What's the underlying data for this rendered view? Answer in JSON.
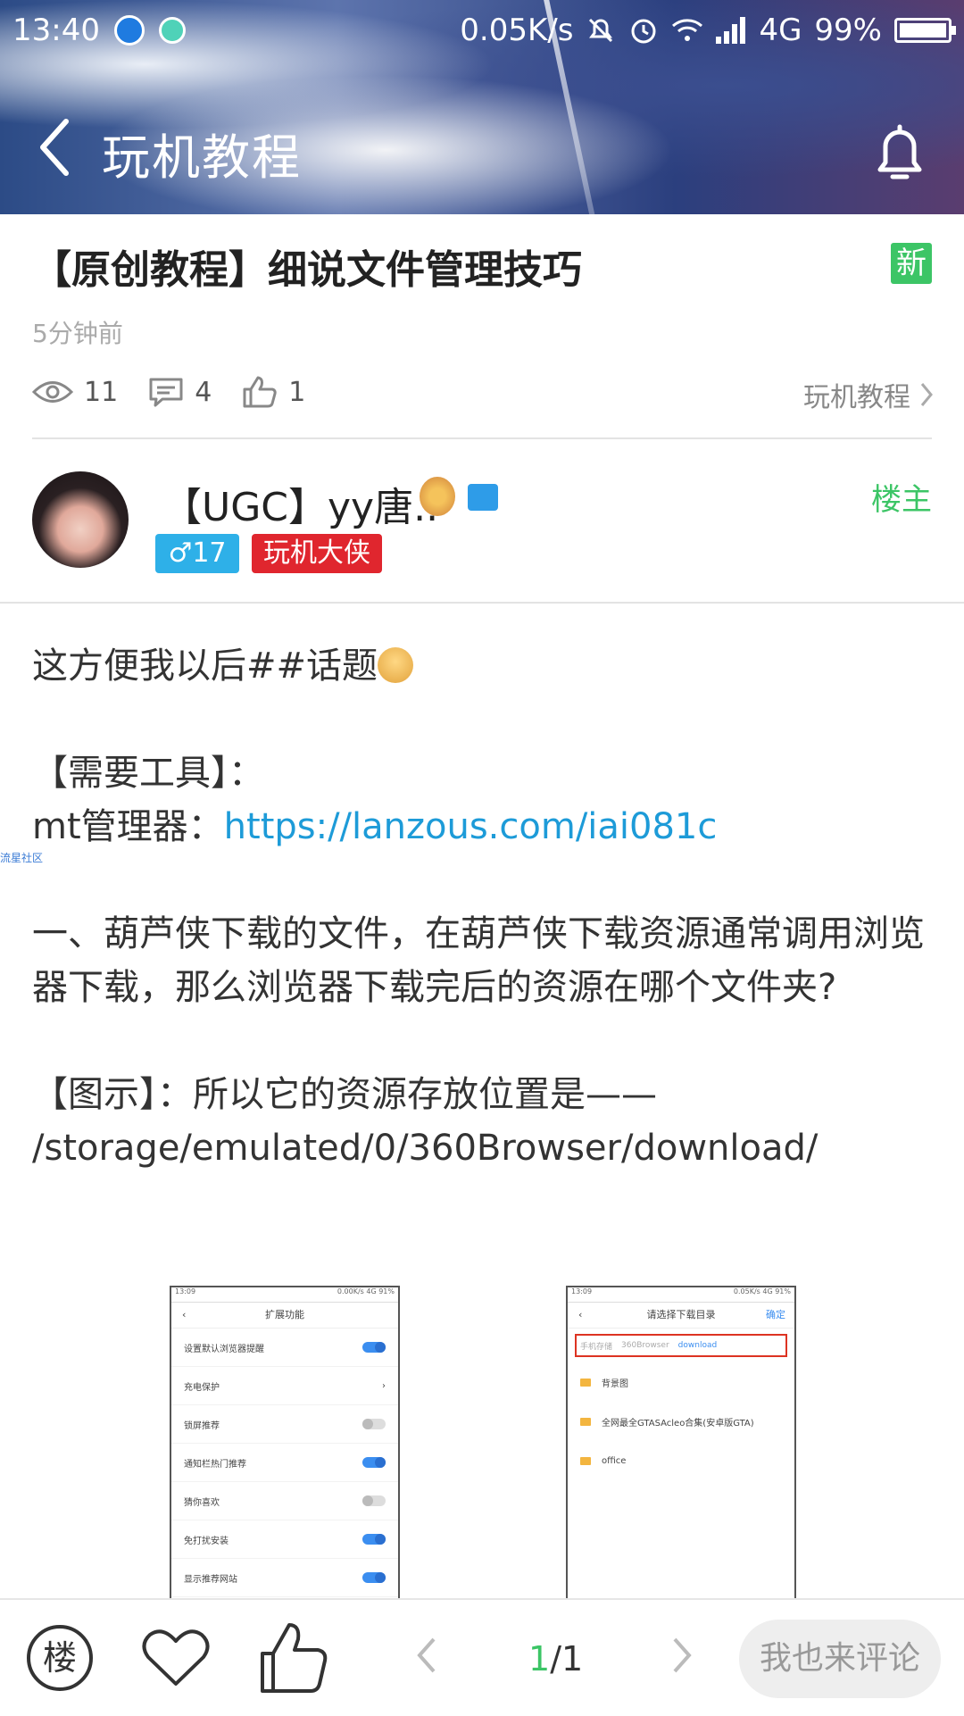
{
  "status_bar": {
    "time": "13:40",
    "speed": "0.05K/s",
    "network": "4G",
    "battery": "99%"
  },
  "nav": {
    "title": "玩机教程"
  },
  "post": {
    "title": "【原创教程】细说文件管理技巧",
    "badge": "新",
    "time": "5分钟前",
    "views": "11",
    "comments": "4",
    "likes": "1",
    "category": "玩机教程"
  },
  "author": {
    "name": "【UGC】yy唐..",
    "gender_level": "♂17",
    "rank": "玩机大侠",
    "op_label": "楼主"
  },
  "content": {
    "line1": "这方便我以后##话题",
    "tools_heading": "【需要工具】：",
    "tool_label": "mt管理器：",
    "tool_link": "https://lanzous.com/iai081c",
    "watermark": "流星社区",
    "para1": "一、葫芦侠下载的文件，在葫芦侠下载资源通常调用浏览器下载，那么浏览器下载完后的资源在哪个文件夹?",
    "figure_label": "【图示】：所以它的资源存放位置是——",
    "path": "/storage/emulated/0/360Browser/download/"
  },
  "screenshot1": {
    "time": "13:09",
    "status": "0.00K/s 4G 91%",
    "title": "扩展功能",
    "rows": [
      {
        "label": "设置默认浏览器提醒"
      },
      {
        "label": "充电保护"
      },
      {
        "label": "锁屏推荐"
      },
      {
        "label": "通知栏热门推荐"
      },
      {
        "label": "猜你喜欢"
      },
      {
        "label": "免打扰安装"
      },
      {
        "label": "显示推荐网站"
      }
    ]
  },
  "screenshot2": {
    "time": "13:09",
    "status": "0.05K/s 4G 91%",
    "title": "请选择下载目录",
    "confirm": "确定",
    "crumbs": [
      "手机存储",
      "360Browser",
      "download"
    ],
    "folders": [
      "背景图",
      "全网最全GTASAcleo合集(安卓版GTA)",
      "office"
    ]
  },
  "bottom": {
    "floor_icon": "楼",
    "page_current": "1",
    "page_total": "/1",
    "comment_placeholder": "我也来评论"
  }
}
